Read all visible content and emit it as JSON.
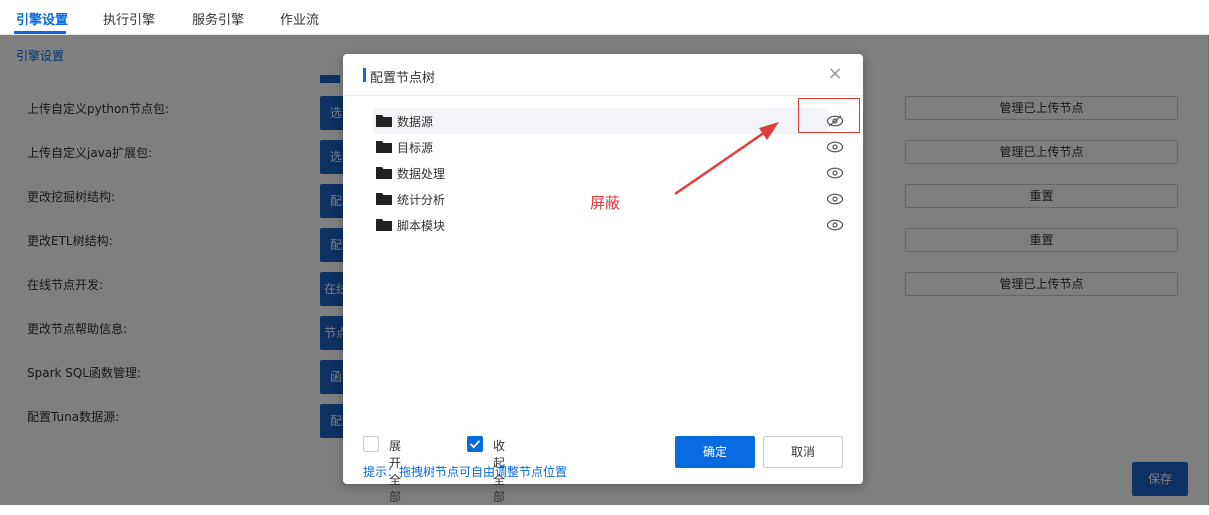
{
  "tabs": [
    {
      "label": "引擎设置",
      "active": true
    },
    {
      "label": "执行引擎",
      "active": false
    },
    {
      "label": "服务引擎",
      "active": false
    },
    {
      "label": "作业流",
      "active": false
    }
  ],
  "content": {
    "section_title": "引擎设置",
    "rows": [
      {
        "label": "上传自定义python节点包:",
        "action": "选",
        "manage": "管理已上传节点"
      },
      {
        "label": "上传自定义java扩展包:",
        "action": "选",
        "manage": "管理已上传节点"
      },
      {
        "label": "更改挖掘树结构:",
        "action": "配",
        "manage": "重置"
      },
      {
        "label": "更改ETL树结构:",
        "action": "配",
        "manage": "重置"
      },
      {
        "label": "在线节点开发:",
        "action": "在线",
        "manage": "管理已上传节点"
      },
      {
        "label": "更改节点帮助信息:",
        "action": "节点",
        "manage": ""
      },
      {
        "label": "Spark SQL函数管理:",
        "action": "函",
        "manage": ""
      },
      {
        "label": "配置Tuna数据源:",
        "action": "配",
        "manage": ""
      }
    ],
    "save_label": "保存"
  },
  "modal": {
    "title": "配置节点树",
    "tree": [
      {
        "label": "数据源",
        "icon": "eye-slash-icon"
      },
      {
        "label": "目标源",
        "icon": "eye-icon"
      },
      {
        "label": "数据处理",
        "icon": "eye-icon"
      },
      {
        "label": "统计分析",
        "icon": "eye-icon"
      },
      {
        "label": "脚本模块",
        "icon": "eye-icon"
      }
    ],
    "expand_all": {
      "label": "展开全部",
      "checked": false
    },
    "collapse_all": {
      "label": "收起全部",
      "checked": true
    },
    "tip": "提示：拖拽树节点可自由调整节点位置",
    "ok_label": "确定",
    "cancel_label": "取消"
  },
  "annotation": {
    "text": "屏蔽",
    "color": "#e03c3c"
  },
  "colors": {
    "accent": "#0a6ae0",
    "button": "#1a63c4",
    "annotation": "#e03c3c"
  }
}
